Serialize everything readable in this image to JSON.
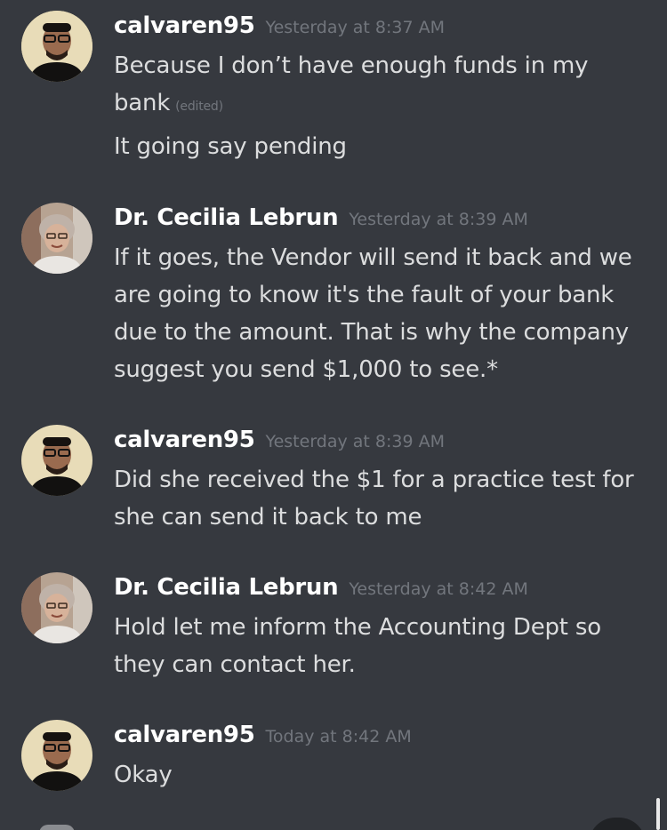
{
  "messages": [
    {
      "author": "calvaren95",
      "timestamp": "Yesterday at 8:37 AM",
      "avatar_icon": "user-avatar-man-icon",
      "lines": [
        "Because I don’t have enough funds in my",
        "bank"
      ],
      "edited_label": "(edited)",
      "extra_lines": [
        "It going say pending"
      ]
    },
    {
      "author": "Dr. Cecilia Lebrun",
      "timestamp": "Yesterday at 8:39 AM",
      "avatar_icon": "user-avatar-woman-icon",
      "lines": [
        "If it goes, the Vendor will send it back and we",
        "are going to know it's the fault of your bank",
        "due to the amount. That is why the company",
        "suggest you send $1,000 to see.*"
      ]
    },
    {
      "author": "calvaren95",
      "timestamp": "Yesterday at 8:39 AM",
      "avatar_icon": "user-avatar-man-icon",
      "lines": [
        "Did she received the $1 for a practice test for",
        "she can send it back to me"
      ]
    },
    {
      "author": "Dr. Cecilia Lebrun",
      "timestamp": "Yesterday at 8:42 AM",
      "avatar_icon": "user-avatar-woman-icon",
      "lines": [
        "Hold let me inform the Accounting Dept so",
        "they can contact her."
      ]
    },
    {
      "author": "calvaren95",
      "timestamp": "Today at 8:42 AM",
      "avatar_icon": "user-avatar-man-icon",
      "lines": [
        "Okay"
      ]
    }
  ],
  "colors": {
    "background": "#36393f",
    "username": "#ffffff",
    "message_text": "#dcddde",
    "timestamp": "#72767d"
  }
}
